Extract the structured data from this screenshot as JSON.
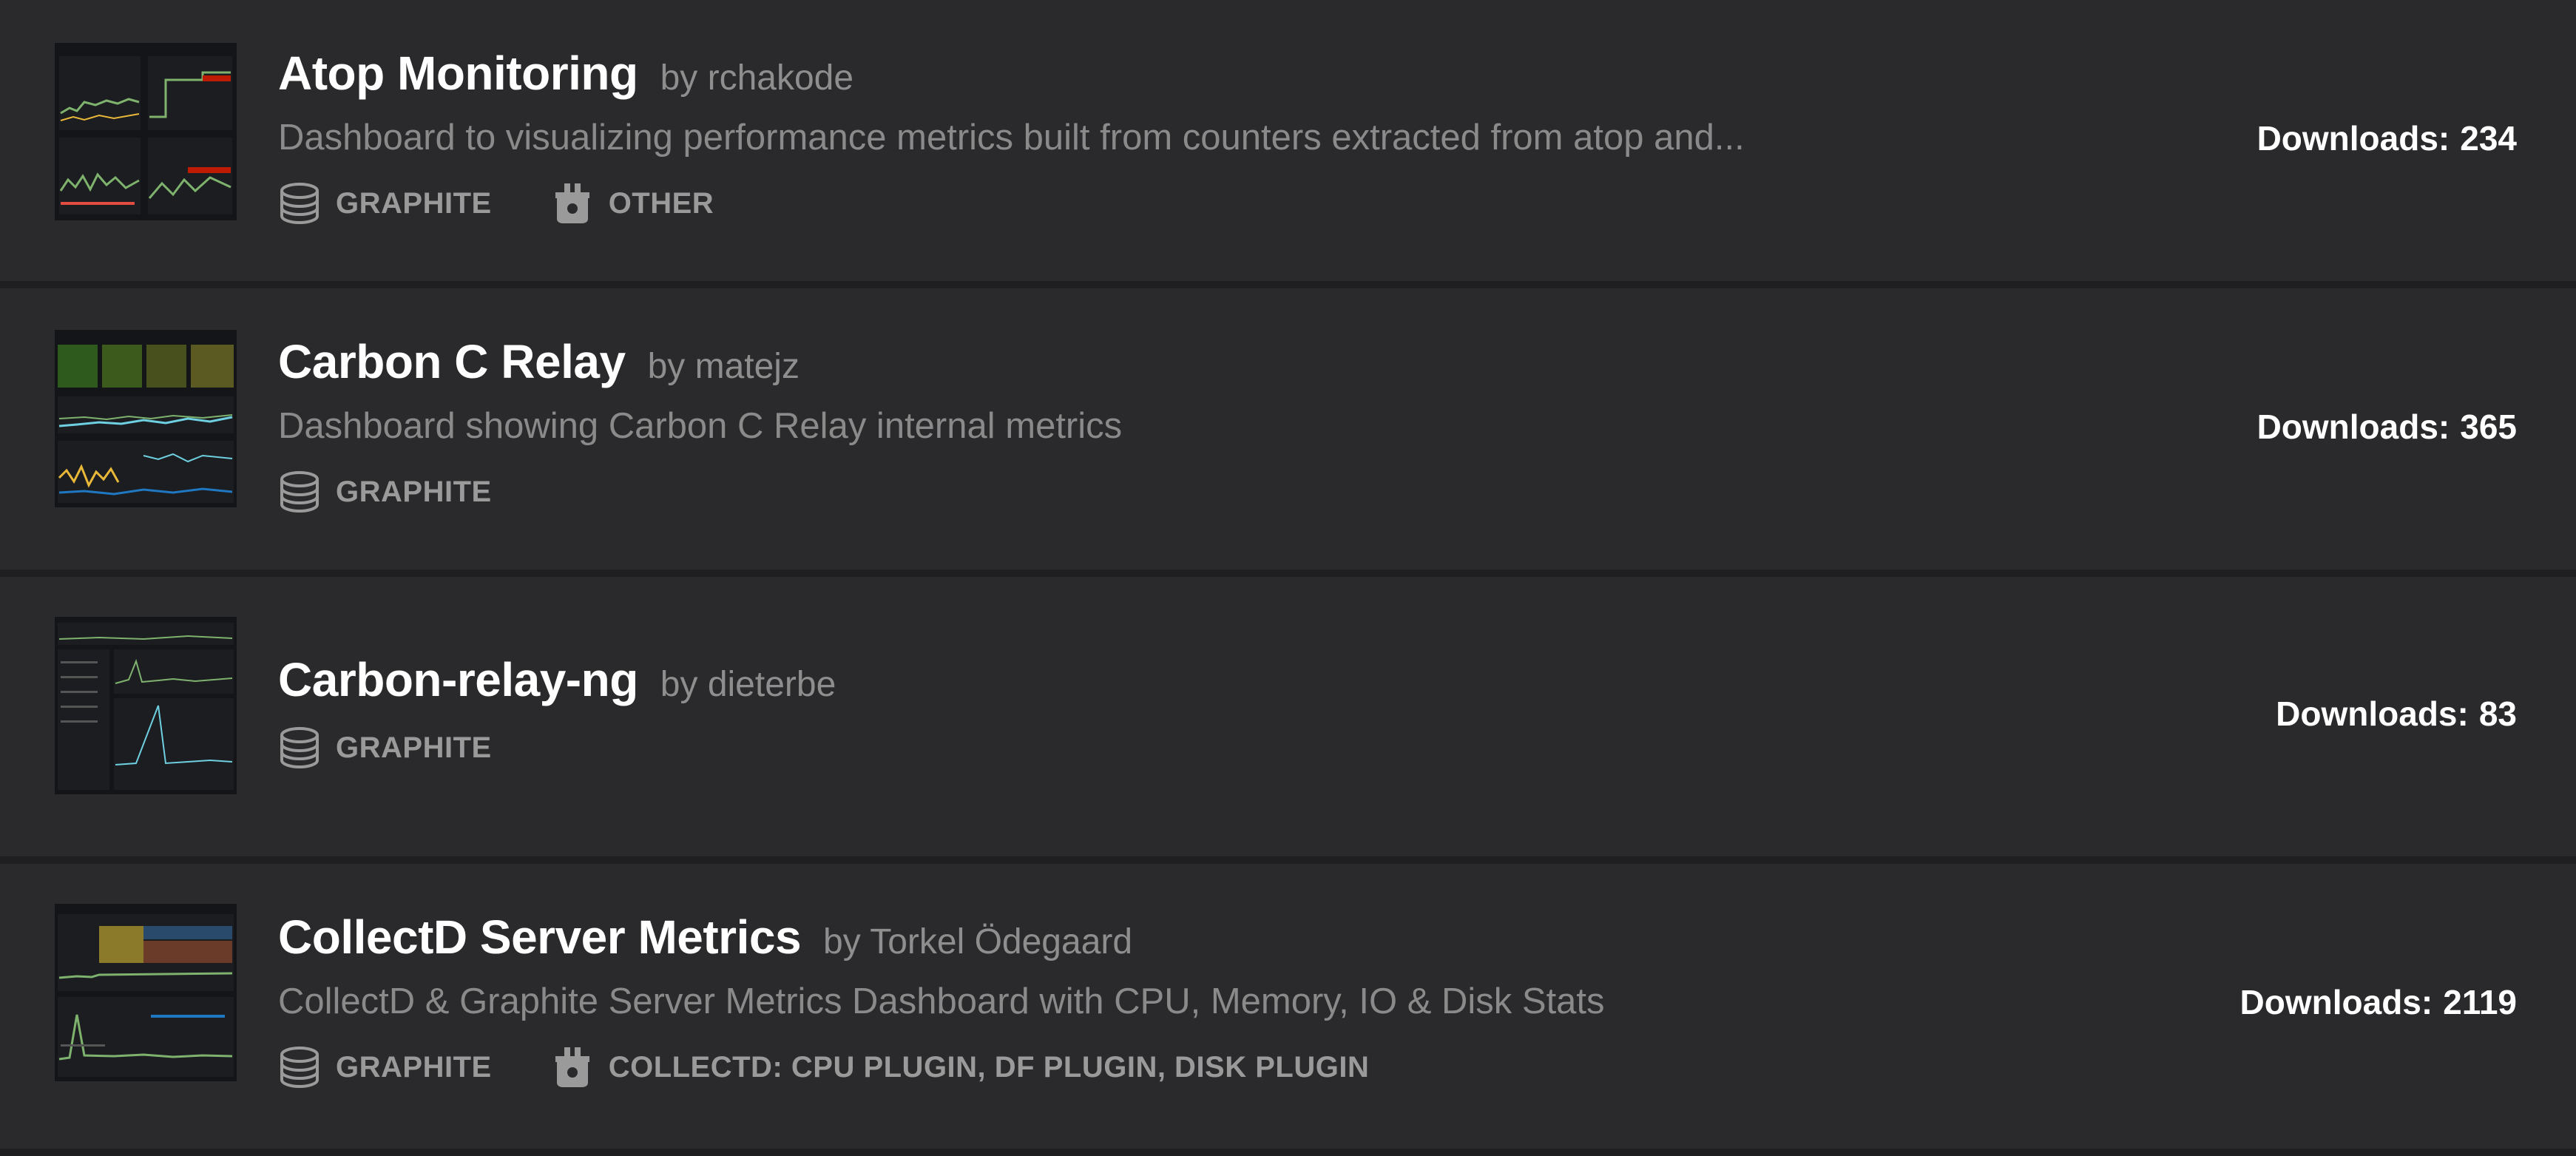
{
  "dashboards": [
    {
      "title": "Atop Monitoring",
      "author": "by rchakode",
      "description": "Dashboard to visualizing performance metrics built from counters extracted from atop and...",
      "tags": [
        {
          "icon": "database-icon",
          "label": "GRAPHITE"
        },
        {
          "icon": "plugin-icon",
          "label": "OTHER"
        }
      ],
      "downloads_label": "Downloads:",
      "downloads": "234"
    },
    {
      "title": "Carbon C Relay",
      "author": "by matejz",
      "description": "Dashboard showing Carbon C Relay internal metrics",
      "tags": [
        {
          "icon": "database-icon",
          "label": "GRAPHITE"
        }
      ],
      "downloads_label": "Downloads:",
      "downloads": "365"
    },
    {
      "title": "Carbon-relay-ng",
      "author": "by dieterbe",
      "description": "",
      "tags": [
        {
          "icon": "database-icon",
          "label": "GRAPHITE"
        }
      ],
      "downloads_label": "Downloads:",
      "downloads": "83"
    },
    {
      "title": "CollectD Server Metrics",
      "author": "by Torkel Ödegaard",
      "description": "CollectD & Graphite Server Metrics Dashboard with CPU, Memory, IO & Disk Stats",
      "tags": [
        {
          "icon": "database-icon",
          "label": "GRAPHITE"
        },
        {
          "icon": "plugin-icon",
          "label": "COLLECTD: CPU PLUGIN, DF PLUGIN, DISK PLUGIN"
        }
      ],
      "downloads_label": "Downloads:",
      "downloads": "2119"
    }
  ],
  "colors": {
    "page_background": "#1f1f21",
    "card_background": "#2a2a2c",
    "title": "#ffffff",
    "muted_text": "#8a8a8a"
  }
}
